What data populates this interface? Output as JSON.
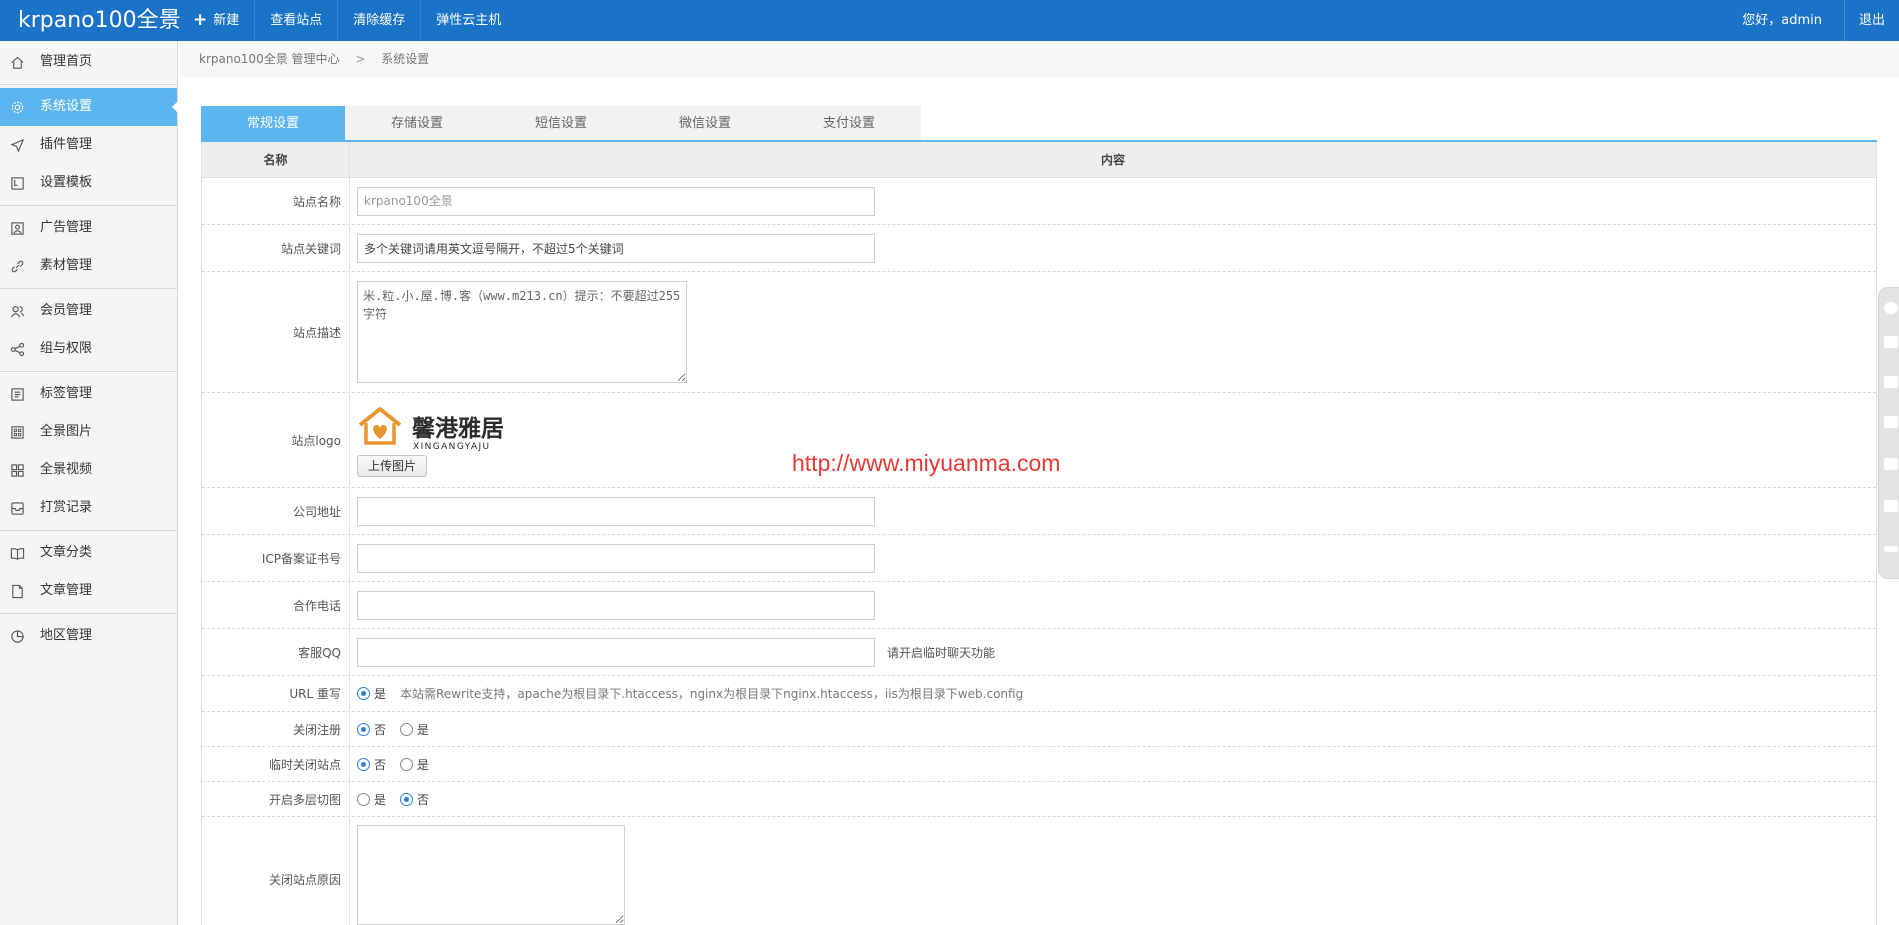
{
  "header": {
    "brand": "krpano100全景",
    "nav": [
      {
        "label": "新建",
        "icon": "plus-icon"
      },
      {
        "label": "查看站点"
      },
      {
        "label": "清除缓存"
      },
      {
        "label": "弹性云主机"
      }
    ],
    "greeting": "您好，admin",
    "logout": "退出"
  },
  "sidebar": {
    "groups": [
      [
        {
          "label": "管理首页",
          "icon": "home-icon"
        }
      ],
      [
        {
          "label": "系统设置",
          "icon": "gear-icon",
          "active": true
        },
        {
          "label": "插件管理",
          "icon": "send-icon"
        },
        {
          "label": "设置模板",
          "icon": "template-icon"
        }
      ],
      [
        {
          "label": "广告管理",
          "icon": "image-icon"
        },
        {
          "label": "素材管理",
          "icon": "link-icon"
        }
      ],
      [
        {
          "label": "会员管理",
          "icon": "users-icon"
        },
        {
          "label": "组与权限",
          "icon": "share-icon"
        }
      ],
      [
        {
          "label": "标签管理",
          "icon": "list-icon"
        },
        {
          "label": "全景图片",
          "icon": "grid-icon"
        },
        {
          "label": "全景视频",
          "icon": "grid-icon"
        },
        {
          "label": "打赏记录",
          "icon": "inbox-icon"
        }
      ],
      [
        {
          "label": "文章分类",
          "icon": "book-icon"
        },
        {
          "label": "文章管理",
          "icon": "file-icon"
        }
      ],
      [
        {
          "label": "地区管理",
          "icon": "pie-icon"
        }
      ]
    ]
  },
  "breadcrumb": {
    "root": "krpano100全景 管理中心",
    "sep": ">",
    "current": "系统设置"
  },
  "tabs": [
    {
      "label": "常规设置",
      "active": true
    },
    {
      "label": "存储设置"
    },
    {
      "label": "短信设置"
    },
    {
      "label": "微信设置"
    },
    {
      "label": "支付设置"
    }
  ],
  "table": {
    "head_name": "名称",
    "head_content": "内容",
    "site_name": {
      "label": "站点名称",
      "placeholder": "krpano100全景"
    },
    "site_keywords": {
      "label": "站点关键词",
      "value": "多个关键词请用英文逗号隔开，不超过5个关键词"
    },
    "site_desc": {
      "label": "站点描述",
      "value": "米.粒.小.屋.博.客（www.m213.cn）提示：不要超过255字符"
    },
    "site_logo": {
      "label": "站点logo",
      "logo_text": "馨港雅居",
      "logo_sub": "XINGANGYAJU",
      "upload": "上传图片"
    },
    "company_addr": {
      "label": "公司地址",
      "value": ""
    },
    "icp": {
      "label": "ICP备案证书号",
      "value": ""
    },
    "phone": {
      "label": "合作电话",
      "value": ""
    },
    "qq": {
      "label": "客服QQ",
      "value": "",
      "hint": "请开启临时聊天功能"
    },
    "rewrite": {
      "label": "URL 重写",
      "opt": "是",
      "hint": "本站需Rewrite支持，apache为根目录下.htaccess，nginx为根目录下nginx.htaccess，iis为根目录下web.config"
    },
    "close_reg": {
      "label": "关闭注册",
      "opt_no": "否",
      "opt_yes": "是"
    },
    "close_site": {
      "label": "临时关闭站点",
      "opt_no": "否",
      "opt_yes": "是"
    },
    "multi_tile": {
      "label": "开启多层切图",
      "opt_yes": "是",
      "opt_no": "否"
    },
    "close_reason": {
      "label": "关闭站点原因",
      "value": ""
    }
  },
  "watermark": "http://www.miyuanma.com",
  "colors": {
    "topbar": "#1a73c6",
    "accent": "#5cb5ee",
    "watermark": "#e53935",
    "logo": "#e8962e"
  }
}
